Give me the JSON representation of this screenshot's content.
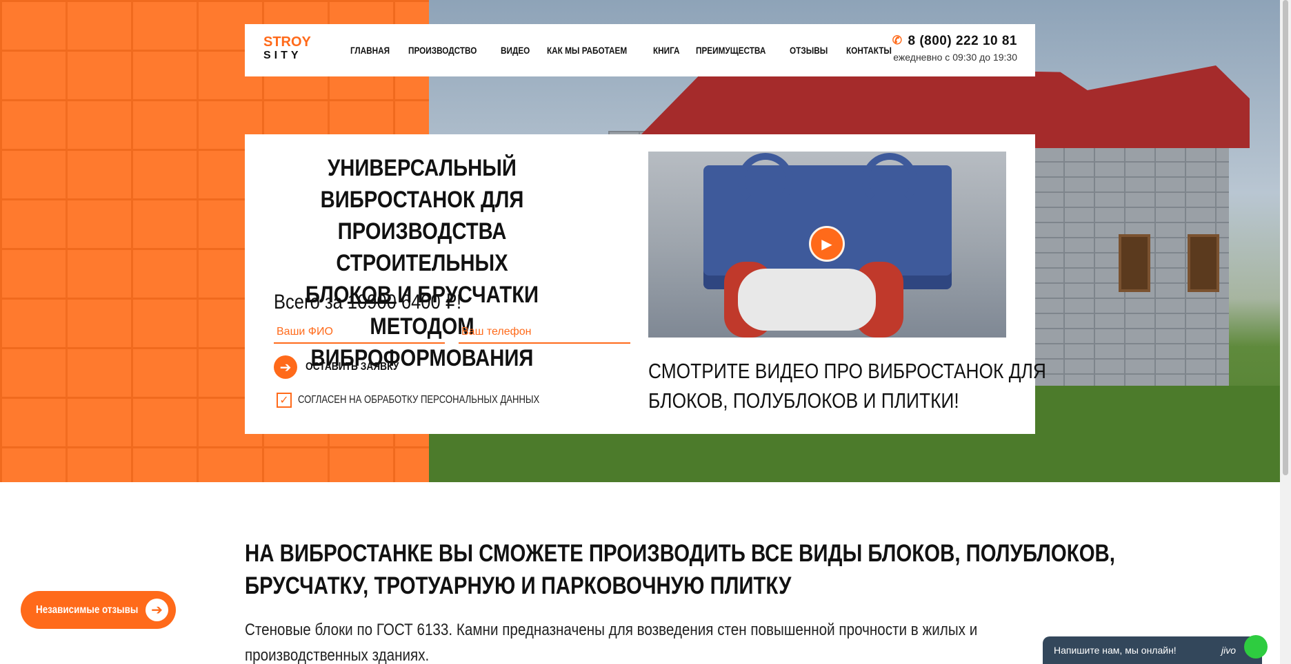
{
  "logo": {
    "top": "STROY",
    "bottom": "SITY"
  },
  "nav": {
    "items": [
      "ГЛАВНАЯ",
      "ПРОИЗВОДСТВО",
      "ВИДЕО",
      "КАК МЫ РАБОТАЕМ",
      "КНИГА",
      "ПРЕИМУЩЕСТВА",
      "ОТЗЫВЫ",
      "КОНТАКТЫ"
    ]
  },
  "contact": {
    "phone": "8 (800) 222 10 81",
    "hours": "ежедневно с 09:30 до 19:30"
  },
  "hero": {
    "title": "УНИВЕРСАЛЬНЫЙ ВИБРОСТАНОК ДЛЯ ПРОИЗВОДСТВА СТРОИТЕЛЬНЫХ БЛОКОВ И БРУСЧАТКИ МЕТОДОМ ВИБРОФОРМОВАНИЯ",
    "price_prefix": "Всего за",
    "price_old": "10900",
    "price_new": "6400 ₽!",
    "name_placeholder": "Ваши ФИО",
    "phone_placeholder": "Ваш телефон",
    "submit_label": "ОСТАВИТЬ ЗАЯВКУ",
    "consent_label": "СОГЛАСЕН НА ОБРАБОТКУ ПЕРСОНАЛЬНЫХ ДАННЫХ",
    "video_caption_line1": "СМОТРИТЕ ВИДЕО ПРО ВИБРОСТАНОК ДЛЯ",
    "video_caption_line2": "БЛОКОВ, ПОЛУБЛОКОВ И ПЛИТКИ!"
  },
  "section": {
    "title_line1": "НА ВИБРОСТАНКЕ ВЫ СМОЖЕТЕ ПРОИЗВОДИТЬ ВСЕ ВИДЫ БЛОКОВ, ПОЛУБЛОКОВ,",
    "title_line2": "БРУСЧАТКУ, ТРОТУАРНУЮ И ПАРКОВОЧНУЮ ПЛИТКУ",
    "text_line1": "Стеновые блоки по ГОСТ 6133. Камни предназначены для возведения стен повышенной прочности в жилых и",
    "text_line2": "производственных зданиях."
  },
  "widgets": {
    "reviews_label": "Независимые отзывы",
    "chat_label": "Напишите нам, мы онлайн!",
    "chat_brand": "jivo"
  },
  "icons": {
    "phone": "phone-icon",
    "play": "play-icon",
    "arrow": "arrow-right-icon",
    "check": "check-icon"
  },
  "colors": {
    "accent": "#ff6a1a",
    "dark": "#111111",
    "chat_bg": "#33475b",
    "chat_online": "#2ecc40"
  }
}
